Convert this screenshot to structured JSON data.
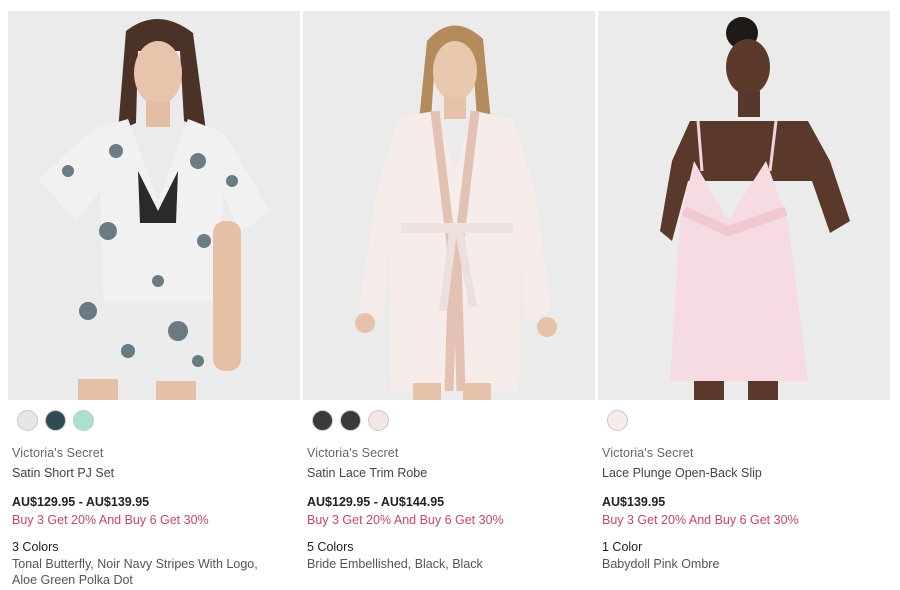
{
  "products": [
    {
      "brand": "Victoria's Secret",
      "name": "Satin Short PJ Set",
      "price": "AU$129.95 - AU$139.95",
      "promo": "Buy 3 Get 20% And Buy 6 Get 30%",
      "color_count": "3 Colors",
      "color_names": "Tonal Butterfly, Noir Navy Stripes With Logo, Aloe Green Polka Dot",
      "image_icon": "model-satin-pj-set-image",
      "swatches": [
        "#e6e6e6",
        "#2f4c55",
        "#a9e0cf"
      ]
    },
    {
      "brand": "Victoria's Secret",
      "name": "Satin Lace Trim Robe",
      "price": "AU$129.95 - AU$144.95",
      "promo": "Buy 3 Get 20% And Buy 6 Get 30%",
      "color_count": "5 Colors",
      "color_names": "Bride Embellished, Black, Black",
      "image_icon": "model-satin-robe-image",
      "swatches": [
        "#3a3a3a",
        "#3a3a3a",
        "#f3e6e6"
      ]
    },
    {
      "brand": "Victoria's Secret",
      "name": "Lace Plunge Open-Back Slip",
      "price": "AU$139.95",
      "promo": "Buy 3 Get 20% And Buy 6 Get 30%",
      "color_count": "1 Color",
      "color_names": "Babydoll Pink Ombre",
      "image_icon": "model-lace-slip-image",
      "swatches": [
        "#f7ecec"
      ]
    }
  ],
  "colors": {
    "promo": "#c8456a",
    "image_bg": "#ebebeb"
  }
}
